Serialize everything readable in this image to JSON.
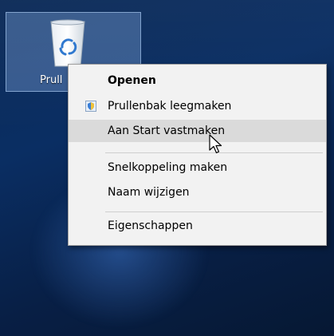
{
  "desktop": {
    "recycle_bin": {
      "label": "Prull",
      "icon": "recycle-bin-icon"
    }
  },
  "context_menu": {
    "items": [
      {
        "label": "Openen",
        "bold": true,
        "hover": false
      },
      {
        "label": "Prullenbak leegmaken",
        "icon": "shield-icon",
        "hover": false
      },
      {
        "label": "Aan Start vastmaken",
        "hover": true
      },
      {
        "label": "Snelkoppeling maken",
        "hover": false
      },
      {
        "label": "Naam wijzigen",
        "hover": false
      },
      {
        "label": "Eigenschappen",
        "hover": false
      }
    ]
  },
  "colors": {
    "desktop_bg": "#0a2e63",
    "selection_fill": "#a0c8ff",
    "menu_bg": "#f2f2f2",
    "menu_hover": "#dadada",
    "shield_blue": "#3a7fd6"
  },
  "cursor": "arrow-cursor-icon"
}
